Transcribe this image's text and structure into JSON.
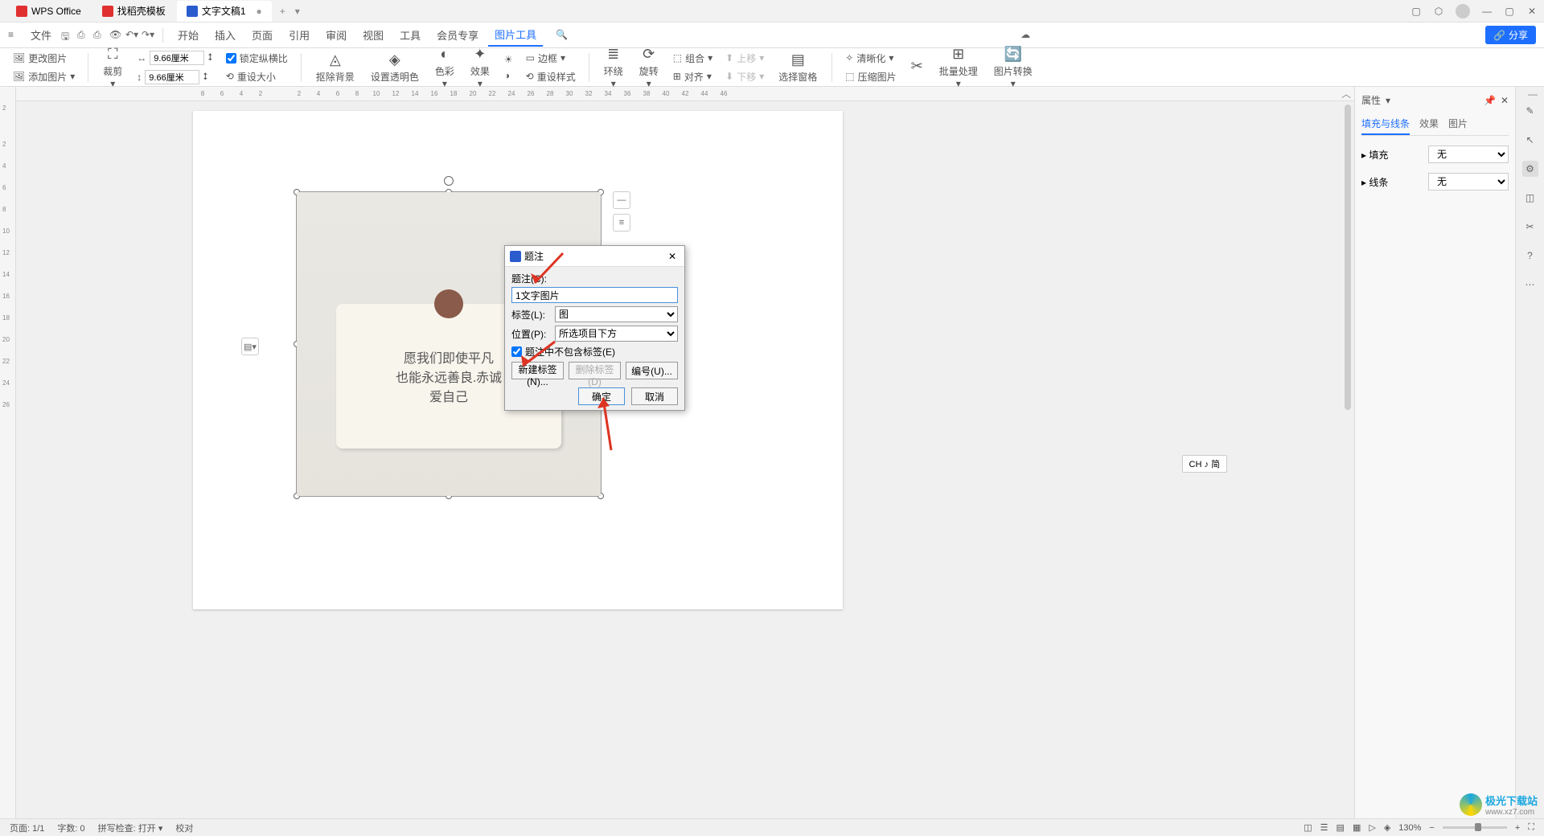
{
  "titlebar": {
    "app": "WPS Office",
    "tabs": [
      {
        "label": "找稻壳模板",
        "icon": "#e03030"
      },
      {
        "label": "文字文稿1",
        "icon": "#2b5cce",
        "active": true
      }
    ]
  },
  "menubar": {
    "file": "文件",
    "items": [
      "开始",
      "插入",
      "页面",
      "引用",
      "审阅",
      "视图",
      "工具",
      "会员专享",
      "图片工具"
    ],
    "active_index": 8,
    "share": "分享"
  },
  "ribbon": {
    "change_image": "更改图片",
    "add_image": "添加图片",
    "crop": "裁剪",
    "width": "9.66厘米",
    "height": "9.66厘米",
    "lock_ratio": "锁定纵横比",
    "reset_size": "重设大小",
    "remove_bg": "抠除背景",
    "set_trans": "设置透明色",
    "color": "色彩",
    "effect": "效果",
    "border": "边框",
    "reset_style": "重设样式",
    "wrap": "环绕",
    "rotate": "旋转",
    "combine": "组合",
    "align": "对齐",
    "move_up": "上移",
    "move_down": "下移",
    "sel_pane": "选择窗格",
    "clarity": "清晰化",
    "compress": "压缩图片",
    "batch": "批量处理",
    "convert": "图片转换"
  },
  "ruler": {
    "h": [
      "8",
      "6",
      "4",
      "2",
      "",
      "2",
      "4",
      "6",
      "8",
      "10",
      "12",
      "14",
      "16",
      "18",
      "20",
      "22",
      "24",
      "26",
      "28",
      "30",
      "32",
      "34",
      "36",
      "38",
      "40",
      "42",
      "44",
      "46"
    ],
    "v": [
      "2",
      "",
      "2",
      "4",
      "6",
      "8",
      "10",
      "12",
      "14",
      "16",
      "18",
      "20",
      "22",
      "24",
      "26"
    ]
  },
  "note_lines": [
    "愿我们即使平凡",
    "也能永远善良.赤诚",
    "爱自己"
  ],
  "dialog": {
    "title": "题注",
    "caption_label": "题注(C):",
    "caption_value": "1文字图片",
    "label_label": "标签(L):",
    "label_value": "图",
    "position_label": "位置(P):",
    "position_value": "所选项目下方",
    "exclude_label": "题注中不包含标签(E)",
    "new_label": "新建标签(N)...",
    "del_label": "删除标签(D)",
    "numbering": "编号(U)...",
    "ok": "确定",
    "cancel": "取消"
  },
  "panel": {
    "title": "属性",
    "tabs": [
      "填充与线条",
      "效果",
      "图片"
    ],
    "fill_label": "填充",
    "fill_value": "无",
    "line_label": "线条",
    "line_value": "无"
  },
  "ch_badge": "CH ♪ 简",
  "statusbar": {
    "page": "页面: 1/1",
    "words": "字数: 0",
    "spell": "拼写检查: 打开",
    "proof": "校对",
    "zoom": "130%"
  },
  "watermark": {
    "name": "极光下载站",
    "url": "www.xz7.com"
  }
}
